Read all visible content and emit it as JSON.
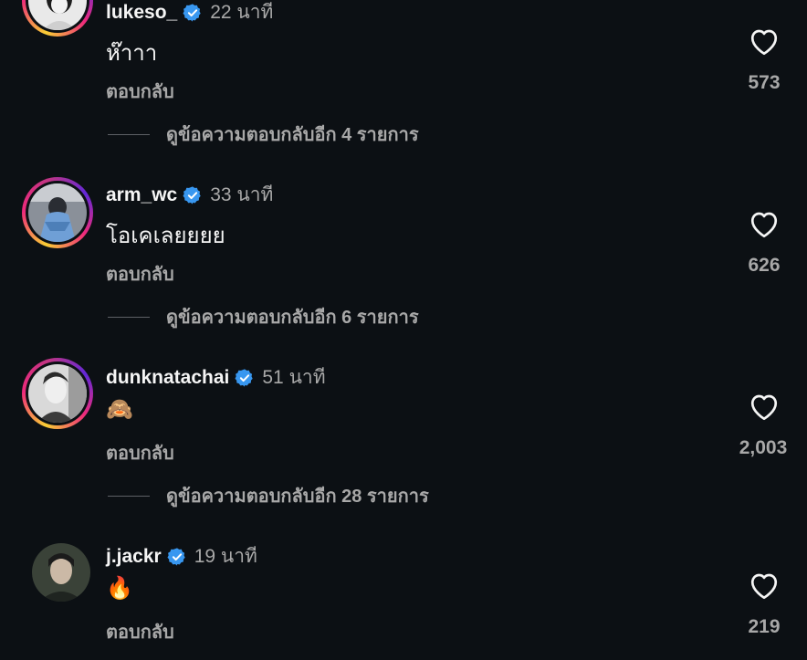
{
  "comments": [
    {
      "username": "lukeso_",
      "time": "22 นาที",
      "text": "ห๊าาา",
      "reply_label": "ตอบกลับ",
      "likes": "573",
      "view_replies": "ดูข้อความตอบกลับอีก 4 รายการ",
      "verified": true
    },
    {
      "username": "arm_wc",
      "time": "33 นาที",
      "text": "โอเคเลยยยย",
      "reply_label": "ตอบกลับ",
      "likes": "626",
      "view_replies": "ดูข้อความตอบกลับอีก 6 รายการ",
      "verified": true
    },
    {
      "username": "dunknatachai",
      "time": "51 นาที",
      "text": "🙈",
      "reply_label": "ตอบกลับ",
      "likes": "2,003",
      "view_replies": "ดูข้อความตอบกลับอีก 28 รายการ",
      "verified": true
    },
    {
      "username": "j.jackr",
      "time": "19 นาที",
      "text": "🔥",
      "reply_label": "ตอบกลับ",
      "likes": "219",
      "verified": true
    }
  ],
  "colors": {
    "background": "#0c1014",
    "verified_badge": "#3897f0",
    "secondary_text": "#a8a8a8"
  },
  "icons": {
    "verified": "verified-badge-icon",
    "like": "heart-outline-icon"
  }
}
